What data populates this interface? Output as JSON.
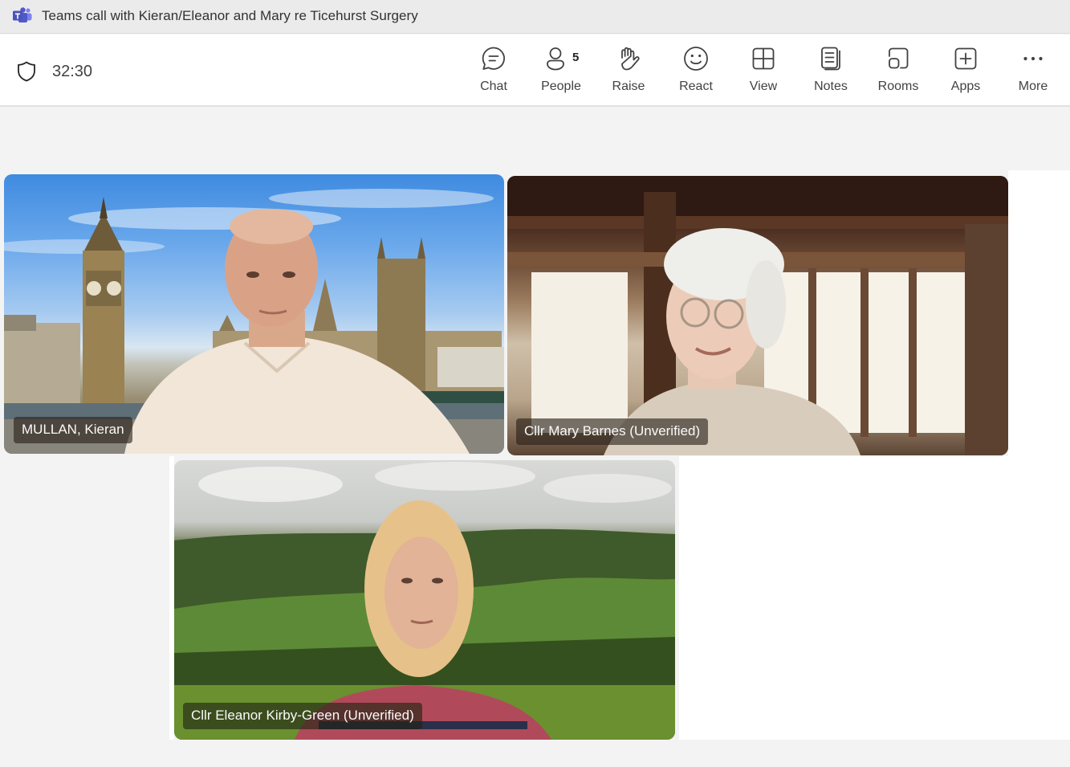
{
  "window": {
    "title": "Teams call with Kieran/Eleanor and Mary re Ticehurst Surgery",
    "app_icon": "microsoft-teams-icon"
  },
  "toolbar": {
    "security_icon": "shield-icon",
    "call_duration": "32:30",
    "buttons": [
      {
        "id": "chat",
        "label": "Chat",
        "icon": "chat-bubble-icon"
      },
      {
        "id": "people",
        "label": "People",
        "icon": "person-icon",
        "badge": "5"
      },
      {
        "id": "raise",
        "label": "Raise",
        "icon": "hand-icon"
      },
      {
        "id": "react",
        "label": "React",
        "icon": "smiley-icon"
      },
      {
        "id": "view",
        "label": "View",
        "icon": "grid-icon"
      },
      {
        "id": "notes",
        "label": "Notes",
        "icon": "notes-icon"
      },
      {
        "id": "rooms",
        "label": "Rooms",
        "icon": "breakout-rooms-icon"
      },
      {
        "id": "apps",
        "label": "Apps",
        "icon": "add-app-icon"
      },
      {
        "id": "more",
        "label": "More",
        "icon": "ellipsis-icon"
      }
    ]
  },
  "participants": [
    {
      "name": "MULLAN, Kieran",
      "scene": "London skyline with Big Ben and Houses of Parliament"
    },
    {
      "name": "Cllr Mary Barnes (Unverified)",
      "scene": "Room with wooden window frames"
    },
    {
      "name": "Cllr Eleanor Kirby-Green (Unverified)",
      "scene": "Green countryside hills"
    }
  ],
  "colors": {
    "teams_purple": "#5b5fc7",
    "toolbar_text": "#424242"
  }
}
